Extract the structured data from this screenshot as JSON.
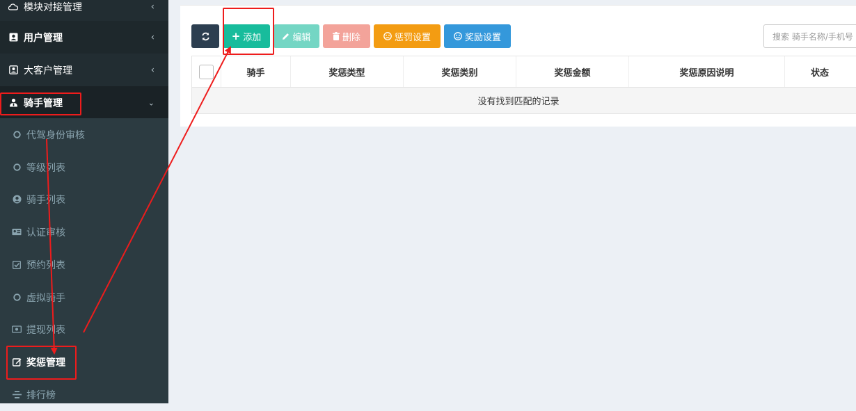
{
  "sidebar": {
    "items": [
      {
        "label": "模块对接管理",
        "icon": "cloud-icon"
      },
      {
        "label": "用户管理",
        "icon": "user-card-icon"
      },
      {
        "label": "大客户管理",
        "icon": "user-card-icon"
      },
      {
        "label": "骑手管理",
        "icon": "rider-icon"
      }
    ],
    "sub_items": [
      {
        "label": "代驾身份审核",
        "icon": "circle-icon"
      },
      {
        "label": "等级列表",
        "icon": "circle-icon"
      },
      {
        "label": "骑手列表",
        "icon": "user-circle-icon"
      },
      {
        "label": "认证审核",
        "icon": "id-card-icon"
      },
      {
        "label": "预约列表",
        "icon": "check-square-icon"
      },
      {
        "label": "虚拟骑手",
        "icon": "circle-icon"
      },
      {
        "label": "提现列表",
        "icon": "money-icon"
      },
      {
        "label": "奖惩管理",
        "icon": "edit-icon"
      },
      {
        "label": "排行榜",
        "icon": "list-icon"
      }
    ]
  },
  "toolbar": {
    "add_label": "添加",
    "edit_label": "编辑",
    "delete_label": "删除",
    "punish_label": "惩罚设置",
    "reward_label": "奖励设置"
  },
  "search": {
    "placeholder": "搜索 骑手名称/手机号"
  },
  "table": {
    "columns": [
      "骑手",
      "奖惩类型",
      "奖惩类别",
      "奖惩金额",
      "奖惩原因说明",
      "状态"
    ],
    "empty_text": "没有找到匹配的记录"
  },
  "colors": {
    "sidebar_bg": "#222d32",
    "submenu_bg": "#2c3b41",
    "add_green": "#18bc9c",
    "punish_orange": "#f39c12",
    "reward_blue": "#3498db",
    "annotation_red": "#ee1c1c"
  }
}
